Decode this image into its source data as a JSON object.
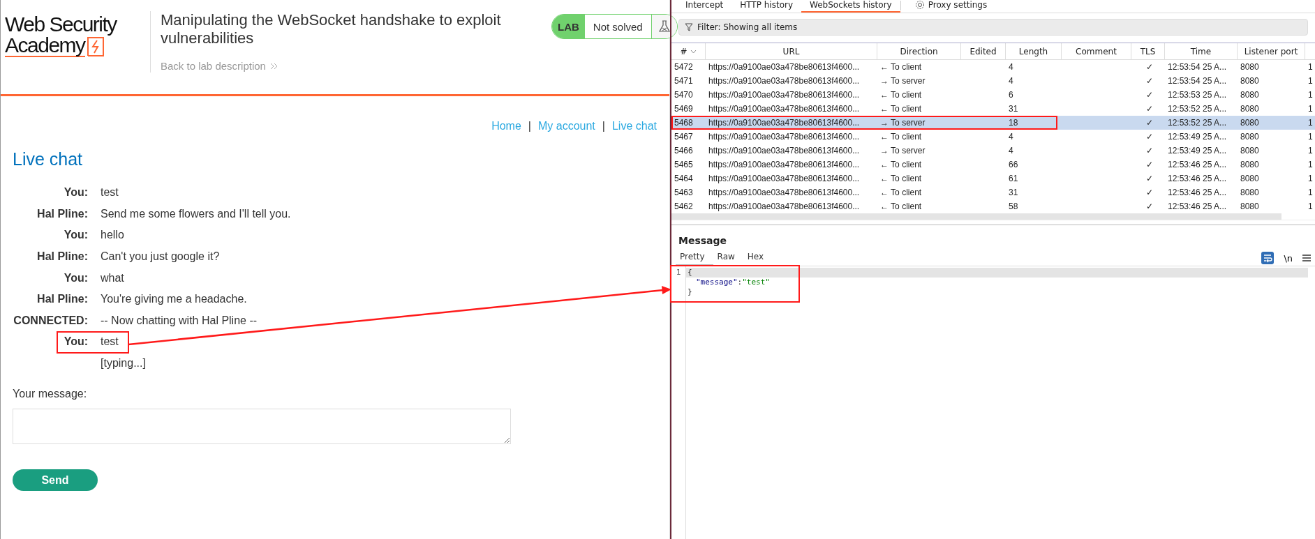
{
  "lab_page": {
    "logo": {
      "line_1": "Web Security",
      "line_2": "Academy"
    },
    "title": "Manipulating the WebSocket handshake to exploit vulnerabilities",
    "back_link": "Back to lab description",
    "status_badge": {
      "label": "LAB",
      "status": "Not solved"
    },
    "nav": {
      "separator": "|",
      "items": [
        {
          "label": "Home"
        },
        {
          "label": "My account"
        },
        {
          "label": "Live chat"
        }
      ]
    },
    "heading": "Live chat",
    "messages": [
      {
        "sender": "You:",
        "text": "test",
        "annotated": false
      },
      {
        "sender": "Hal Pline:",
        "text": "Send me some flowers and I'll tell you.",
        "annotated": false
      },
      {
        "sender": "You:",
        "text": "hello",
        "annotated": false
      },
      {
        "sender": "Hal Pline:",
        "text": "Can't you just google it?",
        "annotated": false
      },
      {
        "sender": "You:",
        "text": "what",
        "annotated": false
      },
      {
        "sender": "Hal Pline:",
        "text": "You're giving me a headache.",
        "annotated": false
      },
      {
        "sender": "CONNECTED:",
        "text": "-- Now chatting with Hal Pline --",
        "annotated": false
      },
      {
        "sender": "You:",
        "text": "test",
        "annotated": true
      },
      {
        "text": "[typing...]",
        "annotated": false
      }
    ],
    "message_label": "Your message:",
    "send_button": "Send"
  },
  "burp": {
    "tabs": [
      {
        "label": "Intercept",
        "kind": "tab",
        "selected": false
      },
      {
        "label": "HTTP history",
        "kind": "tab",
        "selected": false
      },
      {
        "label": "WebSockets history",
        "kind": "tab",
        "selected": true
      },
      {
        "label": "Proxy settings",
        "kind": "settings",
        "selected": false
      }
    ],
    "filter": "Filter: Showing all items",
    "table": {
      "columns": [
        "#",
        "URL",
        "Direction",
        "Edited",
        "Length",
        "Comment",
        "TLS",
        "Time",
        "Listener port"
      ],
      "rows": [
        {
          "num": "5472",
          "url": "https://0a9100ae03a478be80613f4600...",
          "direction": "← To client",
          "length": "4",
          "tls": "✓",
          "time": "12:53:54 25 A...",
          "port": "8080",
          "column_10": "1",
          "selected": false,
          "annotated": false
        },
        {
          "num": "5471",
          "url": "https://0a9100ae03a478be80613f4600...",
          "direction": "→ To server",
          "length": "4",
          "tls": "✓",
          "time": "12:53:54 25 A...",
          "port": "8080",
          "column_10": "1",
          "selected": false,
          "annotated": false
        },
        {
          "num": "5470",
          "url": "https://0a9100ae03a478be80613f4600...",
          "direction": "← To client",
          "length": "6",
          "tls": "✓",
          "time": "12:53:53 25 A...",
          "port": "8080",
          "column_10": "1",
          "selected": false,
          "annotated": false
        },
        {
          "num": "5469",
          "url": "https://0a9100ae03a478be80613f4600...",
          "direction": "← To client",
          "length": "31",
          "tls": "✓",
          "time": "12:53:52 25 A...",
          "port": "8080",
          "column_10": "1",
          "selected": false,
          "annotated": false
        },
        {
          "num": "5468",
          "url": "https://0a9100ae03a478be80613f4600...",
          "direction": "→ To server",
          "length": "18",
          "tls": "✓",
          "time": "12:53:52 25 A...",
          "port": "8080",
          "column_10": "1",
          "selected": true,
          "annotated": true
        },
        {
          "num": "5467",
          "url": "https://0a9100ae03a478be80613f4600...",
          "direction": "← To client",
          "length": "4",
          "tls": "✓",
          "time": "12:53:49 25 A...",
          "port": "8080",
          "column_10": "1",
          "selected": false,
          "annotated": false
        },
        {
          "num": "5466",
          "url": "https://0a9100ae03a478be80613f4600...",
          "direction": "→ To server",
          "length": "4",
          "tls": "✓",
          "time": "12:53:49 25 A...",
          "port": "8080",
          "column_10": "1",
          "selected": false,
          "annotated": false
        },
        {
          "num": "5465",
          "url": "https://0a9100ae03a478be80613f4600...",
          "direction": "← To client",
          "length": "66",
          "tls": "✓",
          "time": "12:53:46 25 A...",
          "port": "8080",
          "column_10": "1",
          "selected": false,
          "annotated": false
        },
        {
          "num": "5464",
          "url": "https://0a9100ae03a478be80613f4600...",
          "direction": "← To client",
          "length": "61",
          "tls": "✓",
          "time": "12:53:46 25 A...",
          "port": "8080",
          "column_10": "1",
          "selected": false,
          "annotated": false
        },
        {
          "num": "5463",
          "url": "https://0a9100ae03a478be80613f4600...",
          "direction": "← To client",
          "length": "31",
          "tls": "✓",
          "time": "12:53:46 25 A...",
          "port": "8080",
          "column_10": "1",
          "selected": false,
          "annotated": false
        },
        {
          "num": "5462",
          "url": "https://0a9100ae03a478be80613f4600...",
          "direction": "← To client",
          "length": "58",
          "tls": "✓",
          "time": "12:53:46 25 A...",
          "port": "8080",
          "column_10": "1",
          "selected": false,
          "annotated": false
        }
      ]
    },
    "message": {
      "heading": "Message",
      "tabs": [
        {
          "label": "Pretty",
          "selected": true
        },
        {
          "label": "Raw",
          "selected": false
        },
        {
          "label": "Hex",
          "selected": false
        }
      ],
      "newline_toggle": "\\n",
      "editor": {
        "annotated": true,
        "line_numbers": [
          "1"
        ],
        "lines": [
          {
            "kind": "plain",
            "text": "{",
            "current": true
          },
          {
            "kind": "pair",
            "key": "\"message\"",
            "sep": ":",
            "value": "\"test\"",
            "current": false
          },
          {
            "kind": "plain",
            "text": "}",
            "current": false
          }
        ]
      }
    }
  },
  "annotation_arrow": true
}
